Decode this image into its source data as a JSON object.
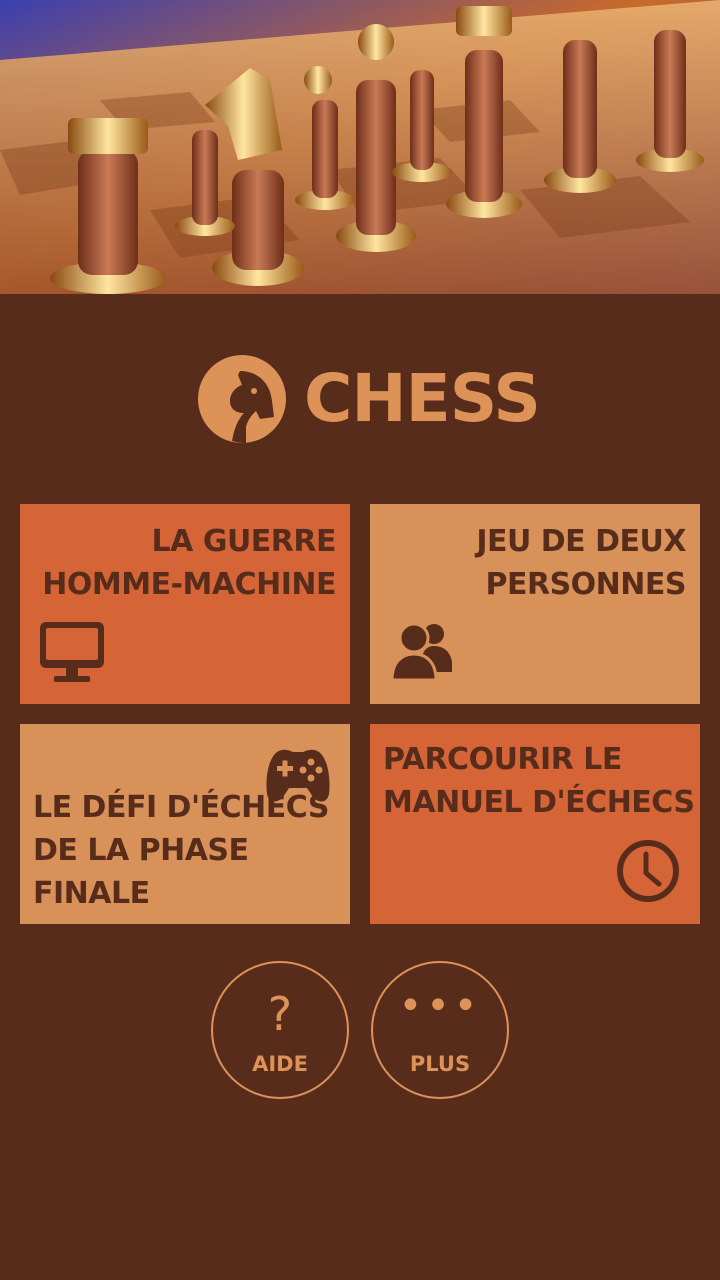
{
  "app": {
    "title": "CHESS"
  },
  "colors": {
    "background": "#582c1b",
    "accent": "#dd9257",
    "tile_dark": "#d56537",
    "tile_light": "#d9915a"
  },
  "tiles": [
    {
      "label": "LA GUERRE\nHOMME-MACHINE",
      "icon": "computer-monitor-icon"
    },
    {
      "label": "JEU DE DEUX\nPERSONNES",
      "icon": "two-users-icon"
    },
    {
      "label": "LE DÉFI D'ÉCHECS\nDE LA PHASE\nFINALE",
      "icon": "gamepad-icon"
    },
    {
      "label": "PARCOURIR LE\nMANUEL D'ÉCHECS",
      "icon": "clock-icon"
    }
  ],
  "buttons": [
    {
      "glyph": "?",
      "label": "AIDE",
      "icon": "question-mark-icon"
    },
    {
      "glyph": "•••",
      "label": "PLUS",
      "icon": "more-dots-icon"
    }
  ]
}
